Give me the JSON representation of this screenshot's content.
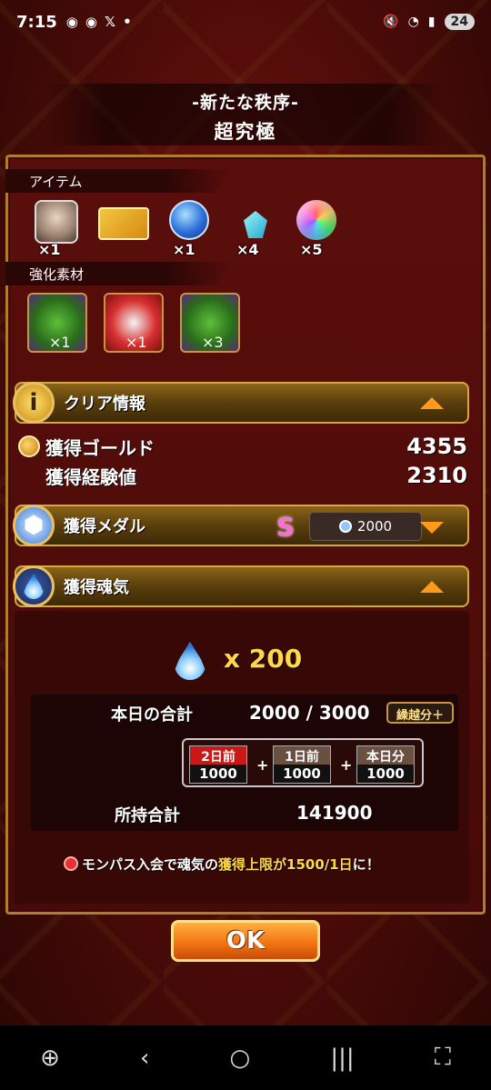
{
  "status_bar": {
    "time": "7:15",
    "notification_icons": [
      "discord-icon",
      "discord-icon",
      "x-icon",
      "dot-icon"
    ],
    "battery": "24"
  },
  "header": {
    "quest_name": "-新たな秩序-",
    "difficulty": "超究極"
  },
  "items_section": {
    "label": "アイテム",
    "items": [
      {
        "icon": "character-portrait",
        "count": "×1"
      },
      {
        "icon": "ticket-icon",
        "count": ""
      },
      {
        "icon": "blue-crystal-icon",
        "count": "×1"
      },
      {
        "icon": "gem-icon",
        "count": "×4"
      },
      {
        "icon": "rainbow-orb-icon",
        "count": "×5"
      }
    ]
  },
  "materials_section": {
    "label": "強化素材",
    "items": [
      {
        "icon": "green-dragon-material",
        "count": "×1"
      },
      {
        "icon": "red-material",
        "count": "×1"
      },
      {
        "icon": "green-dragon-material",
        "count": "×3"
      }
    ]
  },
  "clear_info": {
    "title": "クリア情報",
    "gold_label": "獲得ゴールド",
    "gold_value": "4355",
    "exp_label": "獲得経験値",
    "exp_value": "2310"
  },
  "medal": {
    "title": "獲得メダル",
    "rank": "S",
    "value": "2000"
  },
  "soul": {
    "title": "獲得魂気",
    "multiplier": "x 200",
    "today_total_label": "本日の合計",
    "today_total_value": "2000 / 3000",
    "carryover_label": "繰越分＋",
    "days": [
      {
        "label": "2日前",
        "value": "1000"
      },
      {
        "label": "1日前",
        "value": "1000"
      },
      {
        "label": "本日分",
        "value": "1000"
      }
    ],
    "plus": "+",
    "owned_label": "所持合計",
    "owned_value": "141900"
  },
  "notice": {
    "prefix": "モンパス入会で魂気の",
    "highlight": "獲得上限が1500/1日",
    "suffix": "に！"
  },
  "ok_button": "OK",
  "nav": {
    "back": "‹",
    "home": "○",
    "recents": "|||"
  }
}
